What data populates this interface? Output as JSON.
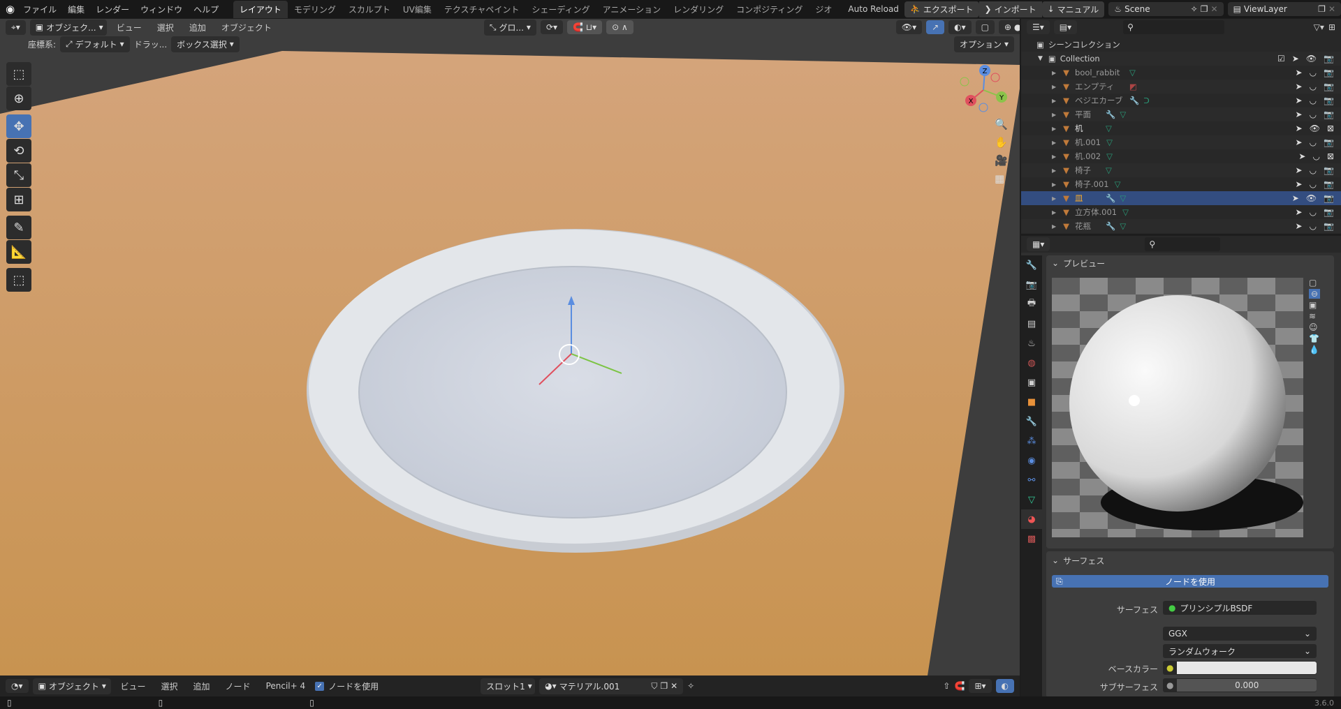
{
  "topbar": {
    "menus": [
      "ファイル",
      "編集",
      "レンダー",
      "ウィンドウ",
      "ヘルプ"
    ],
    "workspaces": [
      "レイアウト",
      "モデリング",
      "スカルプト",
      "UV編集",
      "テクスチャペイント",
      "シェーディング",
      "アニメーション",
      "レンダリング",
      "コンポジティング",
      "ジオ"
    ],
    "auto_reload": "Auto Reload",
    "export": "エクスポート",
    "import": "インポート",
    "manual": "マニュアル",
    "scene": "Scene",
    "view_layer": "ViewLayer"
  },
  "viewport": {
    "mode": "オブジェク...",
    "menus": [
      "ビュー",
      "選択",
      "追加",
      "オブジェクト"
    ],
    "transform": "グロ...",
    "coord_label": "座標系:",
    "coord_value": "デフォルト",
    "drag": "ドラッ...",
    "select_mode": "ボックス選択",
    "options": "オプション",
    "gizmo": {
      "z": "Z",
      "y": "Y",
      "x": "X"
    },
    "colors": {
      "floor": "#c9955e",
      "plate": "#d7dce4",
      "background": "#3d3d3d"
    }
  },
  "outliner": {
    "scene_collection": "シーンコレクション",
    "collection": "Collection",
    "items": [
      {
        "name": "bool_rabbit"
      },
      {
        "name": "エンプティ"
      },
      {
        "name": "ベジエカーブ"
      },
      {
        "name": "平面"
      },
      {
        "name": "机"
      },
      {
        "name": "机.001"
      },
      {
        "name": "机.002"
      },
      {
        "name": "椅子"
      },
      {
        "name": "椅子.001"
      },
      {
        "name": "皿",
        "selected": true
      },
      {
        "name": "立方体.001"
      },
      {
        "name": "花瓶"
      }
    ]
  },
  "properties": {
    "preview_title": "プレビュー",
    "surface_title": "サーフェス",
    "use_nodes": "ノードを使用",
    "rows": {
      "surface_label": "サーフェス",
      "surface_value": "プリンシプルBSDF",
      "distribution": "GGX",
      "subsurface_method": "ランダムウォーク",
      "base_color_label": "ベースカラー",
      "subsurface_label": "サブサーフェス",
      "subsurface_value": "0.000"
    },
    "base_color": "#e8e8e8"
  },
  "bottom": {
    "mode": "オブジェクト",
    "menus": [
      "ビュー",
      "選択",
      "追加",
      "ノード",
      "Pencil+ 4"
    ],
    "use_nodes": "ノードを使用",
    "slot": "スロット1",
    "material": "マテリアル.001"
  },
  "status": {
    "version": "3.6.0"
  }
}
